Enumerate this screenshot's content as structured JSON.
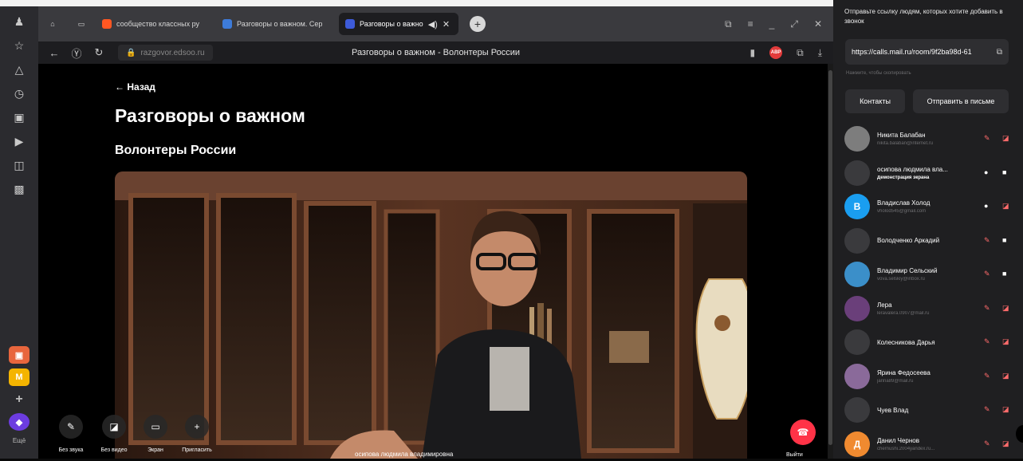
{
  "browser": {
    "tabs": [
      {
        "label": "сообщество классных ру",
        "color": "#ff5722",
        "active": false
      },
      {
        "label": "Разговоры о важном. Сер",
        "color": "#3d7bd9",
        "active": false
      },
      {
        "label": "Разговоры о важно",
        "color": "#3d5bd9",
        "active": true
      }
    ],
    "url": "razgovor.edsoo.ru",
    "page_title": "Разговоры о важном - Волонтеры России",
    "abp_label": "ABP"
  },
  "sidebar": {
    "more_label": "Ещё"
  },
  "page": {
    "back_label": "← Назад",
    "title": "Разговоры о важном",
    "subtitle": "Волонтеры России"
  },
  "call": {
    "buttons": {
      "mute": "Без звука",
      "no_video": "Без видео",
      "screen": "Экран",
      "invite": "Пригласить",
      "exit": "Выйти"
    },
    "speaker": "осипова людмила владимировна"
  },
  "panel": {
    "invite_text": "Отправьте ссылку людям, которых хотите добавить в звонок",
    "link": "https://calls.mail.ru/room/9f2ba98d-61",
    "copy_hint": "Нажмите, чтобы скопировать",
    "contacts_button": "Контакты",
    "email_button": "Отправить в письме",
    "participants": [
      {
        "name": "Никита Балабан",
        "sub": "nikita.balaban@internet.ru",
        "initial": "",
        "color": "#7d7d7d",
        "mic_on": false,
        "cam_on": false
      },
      {
        "name": "осипова людмила вла...",
        "sub": "Демонстрация экрана",
        "initial": "",
        "color": "#3a3a3d",
        "mic_on": true,
        "cam_on": true
      },
      {
        "name": "Владислав Холод",
        "sub": "vholod545@gmail.com",
        "initial": "В",
        "color": "#1a9ef0",
        "mic_on": true,
        "cam_on": false
      },
      {
        "name": "Володченко Аркадий",
        "sub": "",
        "initial": "",
        "color": "#3a3a3d",
        "mic_on": false,
        "cam_on": true
      },
      {
        "name": "Владимир Сельский",
        "sub": "vova.selskiy@inbox.ru",
        "initial": "",
        "color": "#3b8fc9",
        "mic_on": false,
        "cam_on": true
      },
      {
        "name": "Лера",
        "sub": "leravalera.0907@mail.ru",
        "initial": "",
        "color": "#6a3f7a",
        "mic_on": false,
        "cam_on": false
      },
      {
        "name": "Колесникова Дарья",
        "sub": "",
        "initial": "",
        "color": "#3a3a3d",
        "mic_on": false,
        "cam_on": false
      },
      {
        "name": "Ярина Федосеева",
        "sub": "jarina89@mail.ru",
        "initial": "",
        "color": "#8a6a9a",
        "mic_on": false,
        "cam_on": false
      },
      {
        "name": "Чуев Влад",
        "sub": "",
        "initial": "",
        "color": "#3a3a3d",
        "mic_on": false,
        "cam_on": false
      },
      {
        "name": "Данил Чернов",
        "sub": "chernushi.2004yandex.ru...",
        "initial": "Д",
        "color": "#f08a30",
        "mic_on": false,
        "cam_on": false
      }
    ]
  }
}
